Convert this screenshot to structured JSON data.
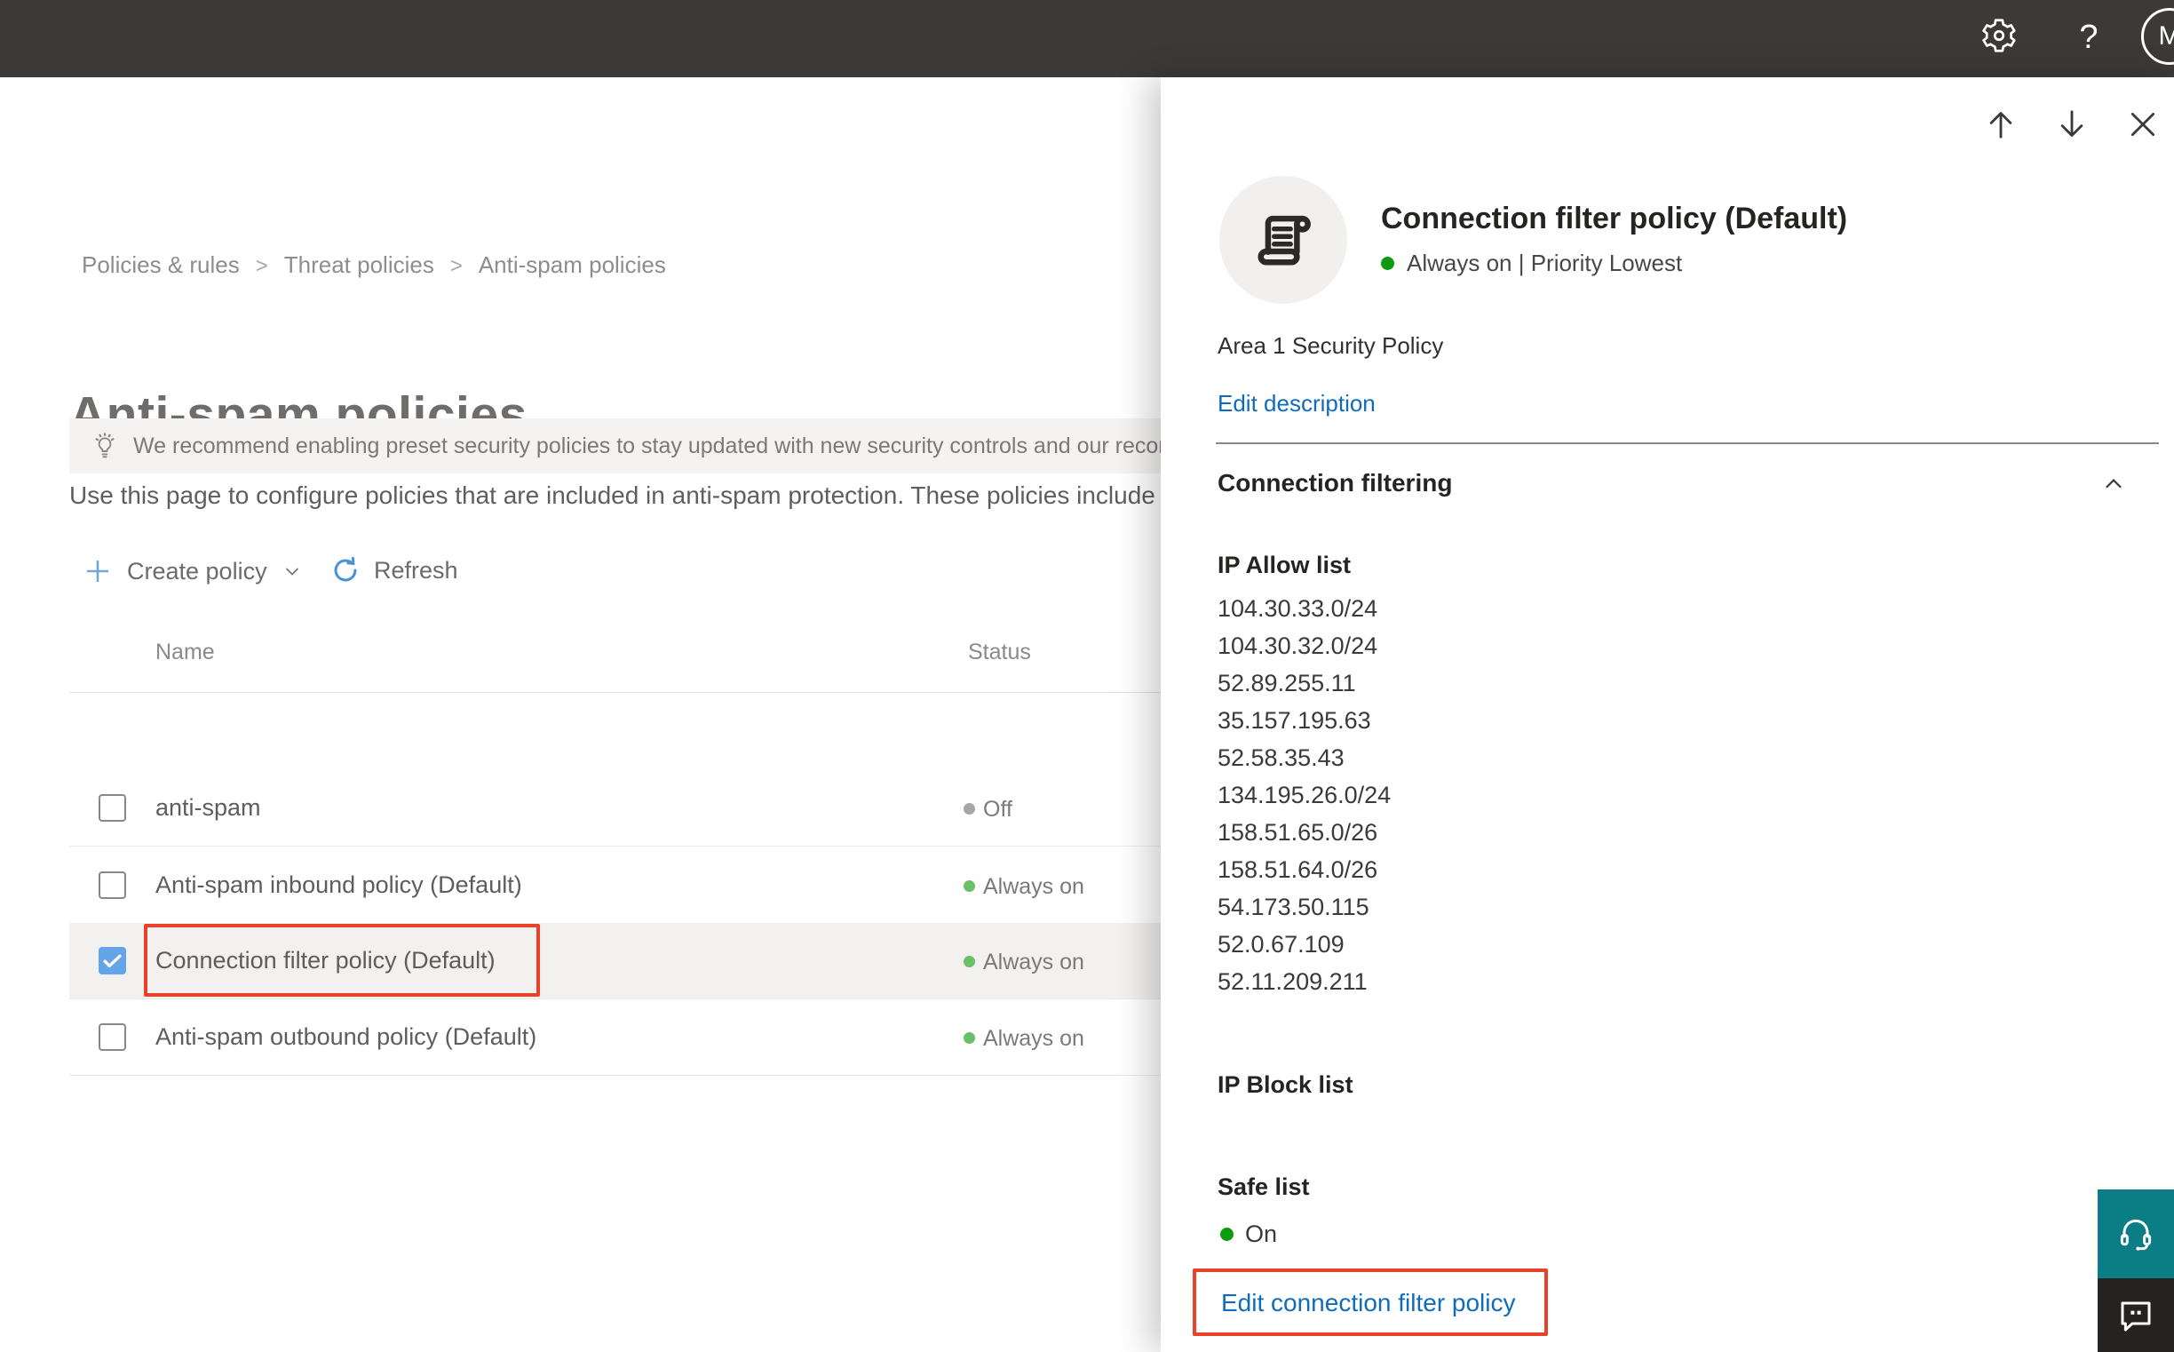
{
  "topbar": {
    "help_label": "?",
    "avatar_initial": "M",
    "icons": [
      "settings-gear-icon",
      "help-icon",
      "account-avatar"
    ]
  },
  "breadcrumb": {
    "items": [
      "Policies & rules",
      "Threat policies",
      "Anti-spam policies"
    ],
    "separator": ">"
  },
  "page": {
    "title": "Anti-spam policies",
    "banner_text": "We recommend enabling preset security policies to stay updated with new security controls and our recomme",
    "description": "Use this page to configure policies that are included in anti-spam protection. These policies include"
  },
  "toolbar": {
    "create_policy": "Create policy",
    "refresh": "Refresh"
  },
  "table": {
    "columns": [
      "Name",
      "Status"
    ],
    "rows": [
      {
        "name": "anti-spam",
        "status": "Off",
        "state": "off",
        "checked": false,
        "selected": false,
        "annotated": false
      },
      {
        "name": "Anti-spam inbound policy (Default)",
        "status": "Always on",
        "state": "on",
        "checked": false,
        "selected": false,
        "annotated": false
      },
      {
        "name": "Connection filter policy (Default)",
        "status": "Always on",
        "state": "on",
        "checked": true,
        "selected": true,
        "annotated": true
      },
      {
        "name": "Anti-spam outbound policy (Default)",
        "status": "Always on",
        "state": "on",
        "checked": false,
        "selected": false,
        "annotated": false
      }
    ]
  },
  "flyout": {
    "title": "Connection filter policy (Default)",
    "status_text": "Always on | Priority Lowest",
    "policy_owner": "Area 1 Security Policy",
    "edit_description_link": "Edit description",
    "section_title": "Connection filtering",
    "ip_allow_title": "IP Allow list",
    "ip_allow_list": [
      "104.30.33.0/24",
      "104.30.32.0/24",
      "52.89.255.11",
      "35.157.195.63",
      "52.58.35.43",
      "134.195.26.0/24",
      "158.51.65.0/26",
      "158.51.64.0/26",
      "54.173.50.115",
      "52.0.67.109",
      "52.11.209.211"
    ],
    "ip_block_title": "IP Block list",
    "safe_list_title": "Safe list",
    "safe_list_status": "On",
    "edit_policy_link": "Edit connection filter policy",
    "icons": [
      "scroll-policy-icon",
      "arrow-up-icon",
      "arrow-down-icon",
      "close-icon",
      "chevron-up-icon"
    ]
  },
  "corner": {
    "icons": [
      "headset-support-icon",
      "feedback-chat-icon"
    ]
  },
  "colors": {
    "topbar_bg": "#3b3a39",
    "accent_blue": "#0f6cbd",
    "plus_blue": "#74a6da",
    "refresh_blue": "#4a90d9",
    "annotation_red": "#e8432a",
    "status_on_green": "#6abf69",
    "status_off_gray": "#a8a6a4",
    "flyout_green": "#0c9b0c",
    "selected_checkbox_blue": "#63a5e8",
    "support_teal": "#0a7e84",
    "feedback_dark": "#242322",
    "row_selected_bg": "#f2f1f0",
    "banner_bg": "#f4f3f2"
  }
}
